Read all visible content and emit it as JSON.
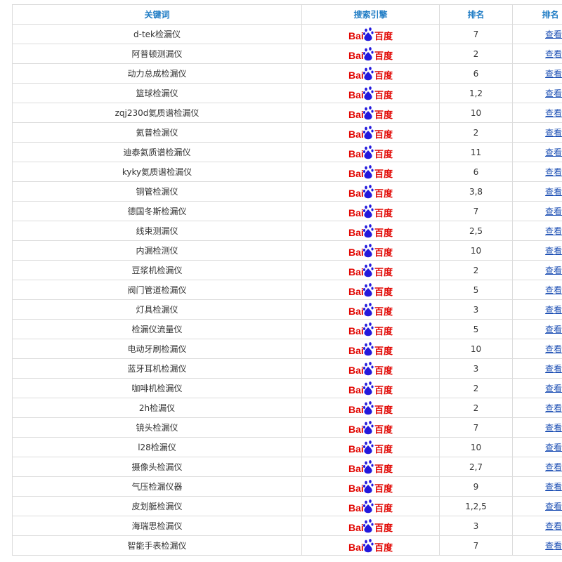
{
  "table": {
    "headers": [
      "关键词",
      "搜索引擎",
      "排名",
      "排名"
    ],
    "engine_logo": {
      "icon": "baidu-logo-icon",
      "text_left": "Bai",
      "text_right": "百度",
      "color_red": "#e10602",
      "color_blue": "#2319dc"
    },
    "view_label": "查看",
    "rows": [
      {
        "keyword": "d-tek检漏仪",
        "rank": "7"
      },
      {
        "keyword": "阿普顿测漏仪",
        "rank": "2"
      },
      {
        "keyword": "动力总成检漏仪",
        "rank": "6"
      },
      {
        "keyword": "篮球检漏仪",
        "rank": "1,2"
      },
      {
        "keyword": "zqj230d氦质谱检漏仪",
        "rank": "10"
      },
      {
        "keyword": "氦普检漏仪",
        "rank": "2"
      },
      {
        "keyword": "迪泰氦质谱检漏仪",
        "rank": "11"
      },
      {
        "keyword": "kyky氦质谱检漏仪",
        "rank": "6"
      },
      {
        "keyword": "铜管检漏仪",
        "rank": "3,8"
      },
      {
        "keyword": "德国冬斯检漏仪",
        "rank": "7"
      },
      {
        "keyword": "线束测漏仪",
        "rank": "2,5"
      },
      {
        "keyword": "内漏检测仪",
        "rank": "10"
      },
      {
        "keyword": "豆浆机检漏仪",
        "rank": "2"
      },
      {
        "keyword": "阀门管道检漏仪",
        "rank": "5"
      },
      {
        "keyword": "灯具检漏仪",
        "rank": "3"
      },
      {
        "keyword": "检漏仪流量仪",
        "rank": "5"
      },
      {
        "keyword": "电动牙刷检漏仪",
        "rank": "10"
      },
      {
        "keyword": "蓝牙耳机检漏仪",
        "rank": "3"
      },
      {
        "keyword": "咖啡机检漏仪",
        "rank": "2"
      },
      {
        "keyword": "2h检漏仪",
        "rank": "2"
      },
      {
        "keyword": "镜头检漏仪",
        "rank": "7"
      },
      {
        "keyword": "l28检漏仪",
        "rank": "10"
      },
      {
        "keyword": "摄像头检漏仪",
        "rank": "2,7"
      },
      {
        "keyword": "气压检漏仪器",
        "rank": "9"
      },
      {
        "keyword": "皮划艇检漏仪",
        "rank": "1,2,5"
      },
      {
        "keyword": "海瑞思检漏仪",
        "rank": "3"
      },
      {
        "keyword": "智能手表检漏仪",
        "rank": "7"
      }
    ]
  }
}
